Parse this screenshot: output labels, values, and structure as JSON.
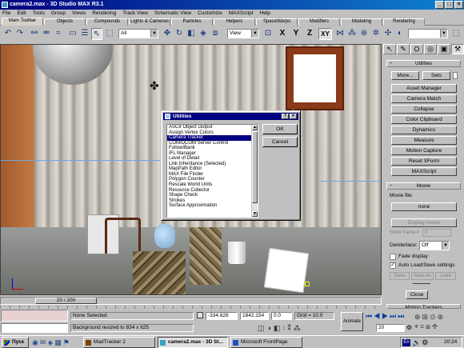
{
  "window": {
    "title": "camera2.max - 3D Studio MAX R3.1"
  },
  "menu": [
    "File",
    "Edit",
    "Tools",
    "Group",
    "Views",
    "Rendering",
    "Track View",
    "Schematic View",
    "Customize",
    "MAXScript",
    "Help"
  ],
  "tabs": [
    "Main Toolbar",
    "Objects",
    "Compounds",
    "Lights & Cameras",
    "Particles",
    "Helpers",
    "SpaceWarps",
    "Modifiers",
    "Modeling",
    "Rendering"
  ],
  "toolbar": {
    "selection_filter": "All",
    "reference_coord": "View",
    "axis_x": "X",
    "axis_y": "Y",
    "axis_z": "Z",
    "axis_xy": "XY",
    "named_selection": ""
  },
  "command_panel": {
    "utilities": {
      "header": "Utilities",
      "more": "More...",
      "sets": "Sets",
      "buttons": [
        "Asset Manager",
        "Camera Match",
        "Collapse",
        "Color Clipboard",
        "Dynamics",
        "Measure",
        "Motion Capture",
        "Reset XForm",
        "MAXScript"
      ]
    },
    "movie": {
      "header": "Movie",
      "movie_file_label": "Movie file:",
      "movie_file_value": "none",
      "display_movie": "Display movie",
      "show_frame_label": "Show frame #",
      "show_frame_value": "0",
      "deinterlace_label": "Deinterlace:",
      "deinterlace_value": "Off",
      "fade_display": "Fade display",
      "auto_load_save": "Auto Load/Save settings",
      "save": "Save",
      "save_as": "Save As",
      "load": "Load",
      "close": "Close"
    },
    "next_header": "Motion Trackers"
  },
  "dialog": {
    "title": "Utilities",
    "items": [
      "ASCII Object Output",
      "Assign Vertex Colors",
      "Camera Tracker",
      "COM/DCOM Server Control",
      "Follow/Bank",
      "IFL Manager",
      "Level of Detail",
      "Link Inheritance (Selected)",
      "MapPath Editor",
      "MAX File Finder",
      "Polygon Counter",
      "Rescale World Units",
      "Resource Collector",
      "Shape Check",
      "Strokes",
      "Surface Approximation"
    ],
    "selected_index": 2,
    "ok": "OK",
    "cancel": "Cancel"
  },
  "timeslider": {
    "label": "20 / 200"
  },
  "status": {
    "selection": "None Selected",
    "prompt": "Background resized to 834 x 625",
    "x": "-334.626",
    "y": "1842.154",
    "z": "0.0",
    "grid": "Grid = 10.0",
    "animate": "Animate",
    "frame": "20"
  },
  "taskbar": {
    "start": "Пуск",
    "tasks": [
      "MadTracker 2",
      "camera2.max - 3D St...",
      "Microsoft FrontPage"
    ],
    "lang": "En",
    "time": "20:24"
  }
}
